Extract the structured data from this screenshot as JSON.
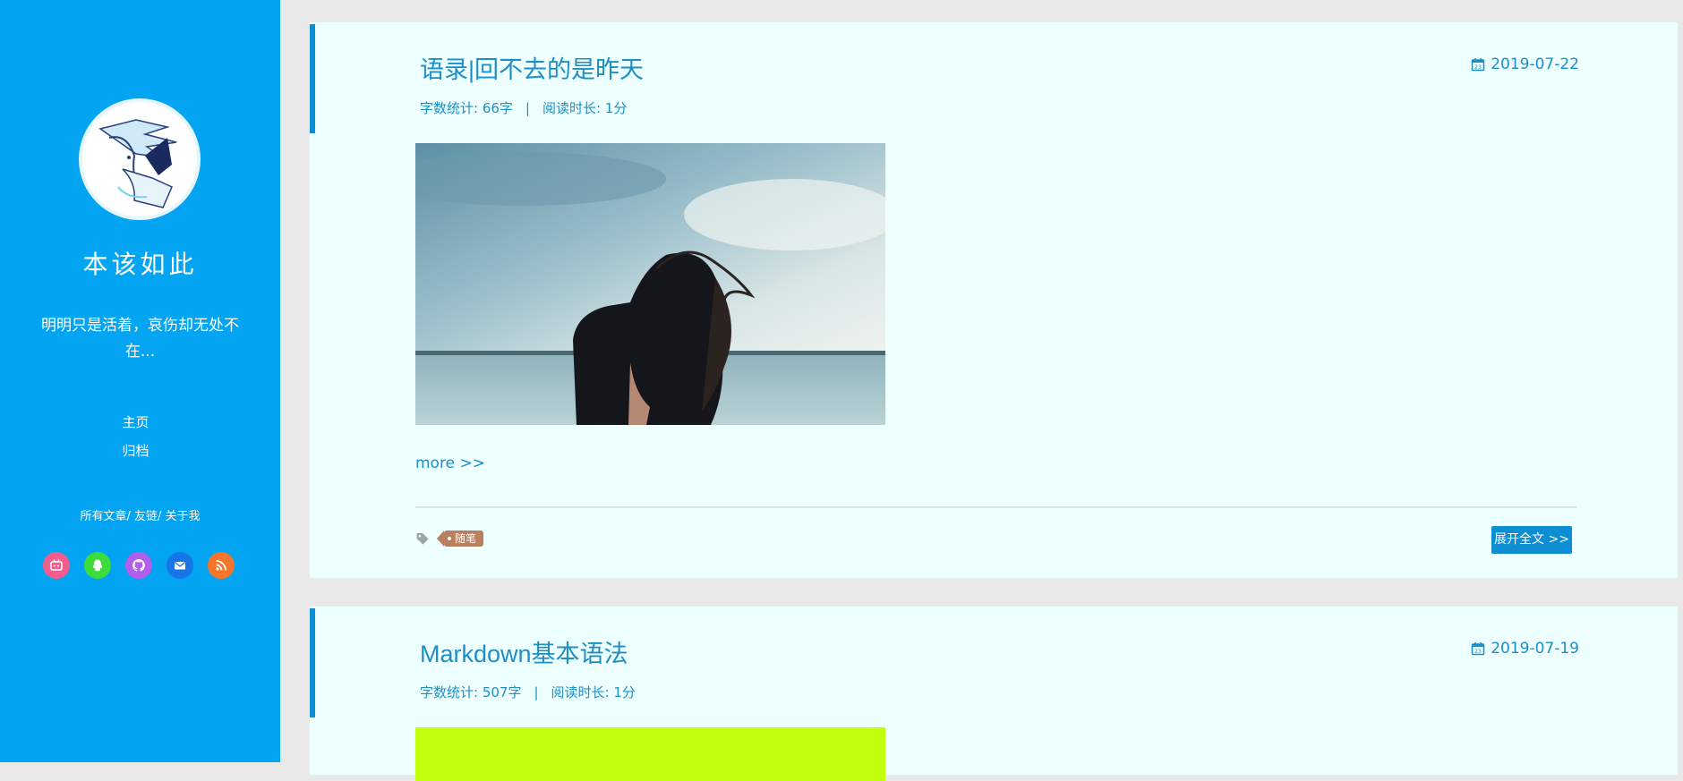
{
  "sidebar": {
    "title": "本该如此",
    "description": "明明只是活着，哀伤却无处不在...",
    "nav": [
      {
        "label": "主页"
      },
      {
        "label": "归档"
      }
    ],
    "links": {
      "all_posts": "所有文章/",
      "friends": "友链/",
      "about": "关于我"
    },
    "social": [
      {
        "icon": "bilibili-icon",
        "color": "#f25d8e"
      },
      {
        "icon": "qq-icon",
        "color": "#3bdc3b"
      },
      {
        "icon": "github-icon",
        "color": "#b15ee8"
      },
      {
        "icon": "mail-icon",
        "color": "#1775e8"
      },
      {
        "icon": "rss-icon",
        "color": "#f5762a"
      }
    ],
    "bg_color": "#03a5f2"
  },
  "posts": [
    {
      "title": "语录|回不去的是昨天",
      "date": "2019-07-22",
      "word_count_label": "字数统计: 66字",
      "sep": "|",
      "read_time_label": "阅读时长: 1分",
      "more": "more >>",
      "tag": "随笔",
      "expand": "展开全文 >>"
    },
    {
      "title": "Markdown基本语法",
      "date": "2019-07-19",
      "word_count_label": "字数统计: 507字",
      "sep": "|",
      "read_time_label": "阅读时长: 1分"
    }
  ],
  "colors": {
    "accent": "#0d8ed3",
    "card_bg": "#edfffe",
    "tag_bg": "#b97f5f",
    "thumb2": "#c3ff0c"
  }
}
